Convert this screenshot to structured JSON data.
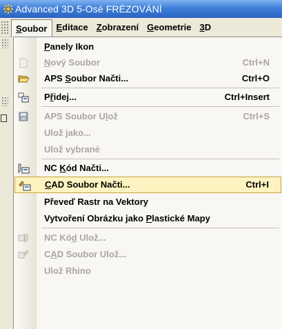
{
  "title": {
    "text": "Advanced 3D 5-Osé FRÉZOVÁNÍ",
    "icon": "app-gear-icon"
  },
  "menubar": {
    "items": [
      {
        "label": "Soubor",
        "mnemonic": "S",
        "active": true
      },
      {
        "label": "Editace",
        "mnemonic": "E"
      },
      {
        "label": "Zobrazení",
        "mnemonic": "Z"
      },
      {
        "label": "Geometrie",
        "mnemonic": "G"
      },
      {
        "label": "3D",
        "mnemonic": "3"
      }
    ]
  },
  "menu": {
    "items": [
      {
        "id": "panely",
        "label": "Panely Ikon",
        "shortcut": "",
        "enabled": true,
        "icon": ""
      },
      {
        "id": "novy",
        "label": "Nový Soubor",
        "shortcut": "Ctrl+N",
        "enabled": false,
        "icon": "new-file-icon"
      },
      {
        "id": "aps_nacti",
        "label": "APS Soubor Načti...",
        "shortcut": "Ctrl+O",
        "enabled": true,
        "icon": "open-folder-icon"
      },
      {
        "id": "pridej",
        "label": "Přidej...",
        "shortcut": "Ctrl+Insert",
        "enabled": true,
        "icon": "add-file-icon"
      },
      {
        "id": "aps_uloz",
        "label": "APS Soubor Ulož",
        "shortcut": "Ctrl+S",
        "enabled": false,
        "icon": "save-disk-icon"
      },
      {
        "id": "uloz_jako",
        "label": "Ulož jako...",
        "shortcut": "",
        "enabled": false,
        "icon": ""
      },
      {
        "id": "uloz_vybrane",
        "label": "Ulož vybrané",
        "shortcut": "",
        "enabled": false,
        "icon": ""
      },
      {
        "id": "nc_nacti",
        "label": "NC Kód Načti...",
        "shortcut": "",
        "enabled": true,
        "icon": "nc-load-icon"
      },
      {
        "id": "cad_nacti",
        "label": "CAD Soubor Načti...",
        "shortcut": "Ctrl+I",
        "enabled": true,
        "icon": "cad-load-icon",
        "highlighted": true
      },
      {
        "id": "prevod",
        "label": "Převeď Rastr na Vektory",
        "shortcut": "",
        "enabled": true,
        "icon": ""
      },
      {
        "id": "vytvoreni",
        "label": "Vytvoření Obrázku jako Plastické Mapy",
        "shortcut": "",
        "enabled": true,
        "icon": ""
      },
      {
        "id": "nc_uloz",
        "label": "NC Kód Ulož...",
        "shortcut": "",
        "enabled": false,
        "icon": "nc-save-icon"
      },
      {
        "id": "cad_uloz",
        "label": "CAD Soubor Ulož...",
        "shortcut": "",
        "enabled": false,
        "icon": "cad-save-icon"
      },
      {
        "id": "rhino",
        "label": "Ulož Rhino",
        "shortcut": "",
        "enabled": false,
        "icon": ""
      }
    ]
  },
  "colors": {
    "titlebar": "#2a63c4",
    "menubar": "#ece9d8",
    "highlight_bg": "#fdf3c0",
    "highlight_border": "#c9a23a",
    "disabled_text": "#a9a79e"
  }
}
